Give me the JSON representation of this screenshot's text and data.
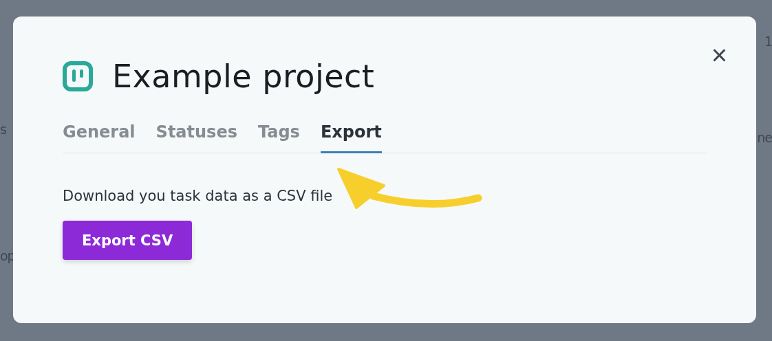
{
  "background": {
    "left_fragments": [
      "s",
      "op"
    ],
    "right_fragments": [
      "1",
      "ne"
    ]
  },
  "dialog": {
    "title": "Example project",
    "close": "×",
    "tabs": [
      {
        "label": "General",
        "selected": false
      },
      {
        "label": "Statuses",
        "selected": false
      },
      {
        "label": "Tags",
        "selected": false
      },
      {
        "label": "Export",
        "selected": true
      }
    ],
    "description": "Download you task data as a CSV file",
    "button": "Export CSV"
  }
}
